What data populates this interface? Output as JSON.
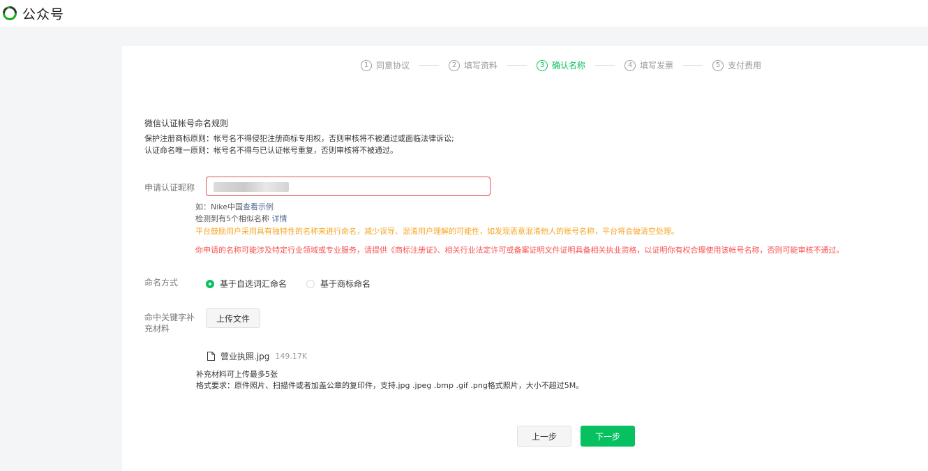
{
  "header": {
    "brand": "公众号",
    "logo_icon": "wechat-official-account-logo",
    "accent_color": "#07c160"
  },
  "steps": [
    {
      "num": "1",
      "label": "同意协议",
      "active": false
    },
    {
      "num": "2",
      "label": "填写资料",
      "active": false
    },
    {
      "num": "3",
      "label": "确认名称",
      "active": true
    },
    {
      "num": "4",
      "label": "填写发票",
      "active": false
    },
    {
      "num": "5",
      "label": "支付费用",
      "active": false
    }
  ],
  "rules": {
    "title": "微信认证帐号命名规则",
    "line1": "保护注册商标原则：帐号名不得侵犯注册商标专用权，否则审核将不被通过或面临法律诉讼;",
    "line2": "认证命名唯一原则：帐号名不得与已认证帐号重复，否则审核将不被通过。"
  },
  "name_field": {
    "label": "申请认证昵称",
    "value": "",
    "example_prefix": "如：Nike中国",
    "example_link": "查看示例",
    "similar_text": "检测到有5个相似名称",
    "similar_link": "详情",
    "warning_orange": "平台鼓励用户采用具有独特性的名称来进行命名，减少误导、混淆用户理解的可能性，如发现恶意混淆他人的账号名称，平台将会做清空处理。",
    "warning_red": "你申请的名称可能涉及特定行业领域或专业服务，请提供《商标注册证》、相关行业法定许可或备案证明文件证明具备相关执业资格，以证明你有权合理使用该帐号名称，否则可能审核不通过。"
  },
  "naming_method": {
    "label": "命名方式",
    "options": [
      {
        "label": "基于自选词汇命名",
        "checked": true
      },
      {
        "label": "基于商标命名",
        "checked": false
      }
    ]
  },
  "materials": {
    "label": "命中关键字补充材料",
    "upload_label": "上传文件",
    "file_name": "营业执照.jpg",
    "file_size": "149.17K",
    "note1": "补充材料可上传最多5张",
    "note2": "格式要求：原件照片、扫描件或者加盖公章的复印件，支持.jpg .jpeg .bmp .gif .png格式照片，大小不超过5M。"
  },
  "actions": {
    "prev_label": "上一步",
    "next_label": "下一步"
  }
}
